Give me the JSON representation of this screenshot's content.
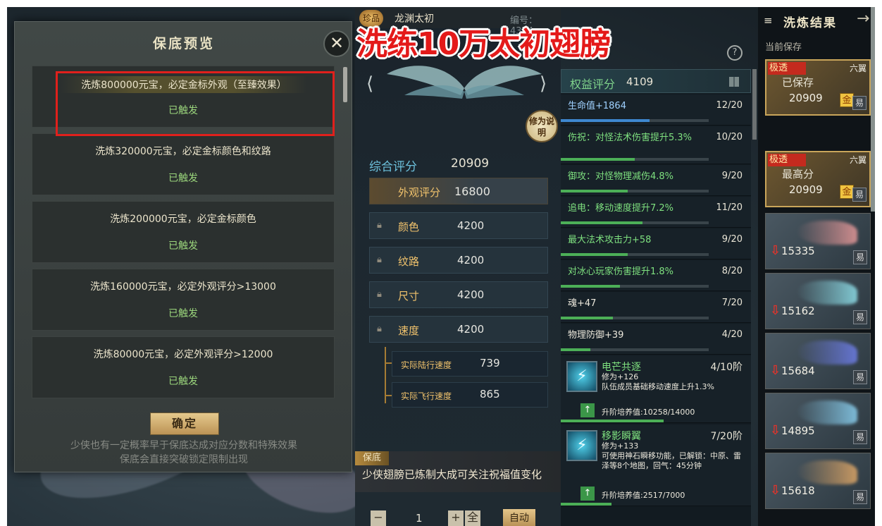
{
  "modal": {
    "title": "保底预览",
    "close": "✕",
    "tiers": [
      {
        "label": "洗炼800000元宝，必定金标外观（至臻效果）",
        "status": "已触发"
      },
      {
        "label": "洗炼320000元宝，必定金标颜色和纹路",
        "status": "已触发"
      },
      {
        "label": "洗炼200000元宝，必定金标颜色",
        "status": "已触发"
      },
      {
        "label": "洗炼160000元宝，必定外观评分>13000",
        "status": "已触发"
      },
      {
        "label": "洗炼80000元宝，必定外观评分>12000",
        "status": "已触发"
      }
    ],
    "confirm": "确定",
    "note_line1": "少侠也有一定概率早于保底达成对应分数和特殊效果",
    "note_line2": "保底会直接突破锁定限制出现"
  },
  "overlay_title": "洗练10万太初翅膀",
  "middle": {
    "rarity": "珍品",
    "wing_name": "龙渊太初",
    "serial": "编号：4374",
    "cultivation_button": "修为说明",
    "total_label": "综合评分",
    "total_value": "20909",
    "appearance_label": "外观评分",
    "appearance_value": "16800",
    "stats": [
      {
        "label": "颜色",
        "value": "4200"
      },
      {
        "label": "纹路",
        "value": "4200"
      },
      {
        "label": "尺寸",
        "value": "4200"
      },
      {
        "label": "速度",
        "value": "4200"
      }
    ],
    "sub_stats": [
      {
        "label": "实际陆行速度",
        "value": "739"
      },
      {
        "label": "实际飞行速度",
        "value": "865"
      }
    ],
    "blessing_tag": "保底",
    "blessing_text": "少侠翅膀已炼制大成可关注祝福值变化",
    "qty_minus": "−",
    "qty_value": "1",
    "qty_plus": "+",
    "qty_max": "全",
    "auto_button": "自动"
  },
  "attributes": {
    "rights_label": "权益评分",
    "rights_value": "4109",
    "rows": [
      {
        "name": "生命值+1864",
        "count": "12/20",
        "progress": 0.6,
        "color": "#9fd1ff"
      },
      {
        "name": "伤祝：对怪法术伤害提升5.3%",
        "count": "10/20",
        "progress": 0.5,
        "color": "#7ee07f"
      },
      {
        "name": "御攻：对怪物理减伤4.8%",
        "count": "9/20",
        "progress": 0.45,
        "color": "#7ee07f"
      },
      {
        "name": "追电：移动速度提升7.2%",
        "count": "11/20",
        "progress": 0.55,
        "color": "#7ee07f"
      },
      {
        "name": "最大法术攻击力+58",
        "count": "9/20",
        "progress": 0.45,
        "color": "#7ee07f"
      },
      {
        "name": "对冰心玩家伤害提升1.8%",
        "count": "8/20",
        "progress": 0.4,
        "color": "#7ee07f"
      },
      {
        "name": "魂+47",
        "count": "7/20",
        "progress": 0.35,
        "color": "#ece8dc"
      },
      {
        "name": "物理防御+39",
        "count": "4/20",
        "progress": 0.2,
        "color": "#ece8dc"
      }
    ],
    "skills": [
      {
        "name": "电芒共逐",
        "count": "4/10阶",
        "desc": "修为+126\n队伍成员基础移动速度上升1.3%",
        "upgrade": "升阶培养值:10258/14000",
        "progress": 0.73
      },
      {
        "name": "移影瞬翼",
        "count": "7/20阶",
        "desc": "修为+133\n可使用神石瞬移功能，已解锁：中原、雷泽等8个地图，回气：45分钟",
        "upgrade": "升阶培养值:2517/7000",
        "progress": 0.36
      }
    ]
  },
  "results": {
    "title": "洗炼结果",
    "saved_label": "当前保存",
    "cards": [
      {
        "tag": "极透",
        "wings": "六翼",
        "label": "已保存",
        "score": "20909",
        "gold": "金",
        "easy": "易"
      },
      {
        "tag": "极透",
        "wings": "六翼",
        "label": "最高分",
        "score": "20909",
        "gold": "金",
        "easy": "易"
      }
    ],
    "history": [
      {
        "score": "15335",
        "easy": "易",
        "hue": "#e89a9a"
      },
      {
        "score": "15162",
        "easy": "易",
        "hue": "#8fe0ea"
      },
      {
        "score": "15684",
        "easy": "易",
        "hue": "#6e7ee8"
      },
      {
        "score": "14895",
        "easy": "易",
        "hue": "#8ad0f0"
      },
      {
        "score": "15618",
        "easy": "易",
        "hue": "#e0a868"
      }
    ]
  }
}
